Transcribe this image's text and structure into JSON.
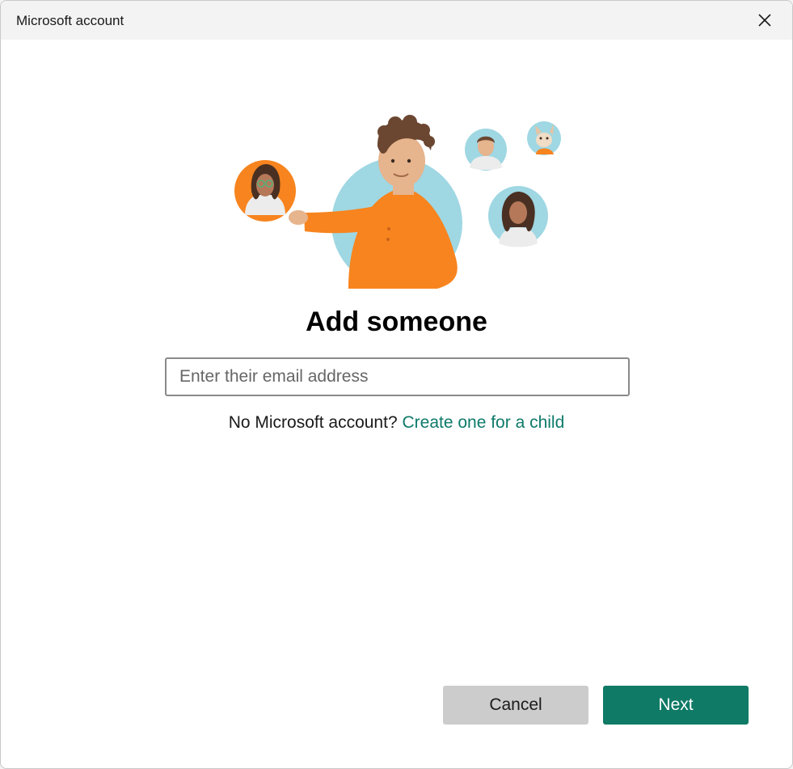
{
  "window": {
    "title": "Microsoft account",
    "close_icon": "close-icon"
  },
  "illustration": {
    "description_icon": "people-illustration"
  },
  "main": {
    "heading": "Add someone",
    "email_placeholder": "Enter their email address",
    "email_value": "",
    "no_account_text": "No Microsoft account?",
    "child_link": "Create one for a child"
  },
  "footer": {
    "cancel_label": "Cancel",
    "next_label": "Next"
  },
  "colors": {
    "accent": "#0f7a66",
    "link": "#0e7a6a",
    "cancel_bg": "#cccccc",
    "illustration_orange": "#f7841e",
    "illustration_blue": "#9fd7e3"
  }
}
